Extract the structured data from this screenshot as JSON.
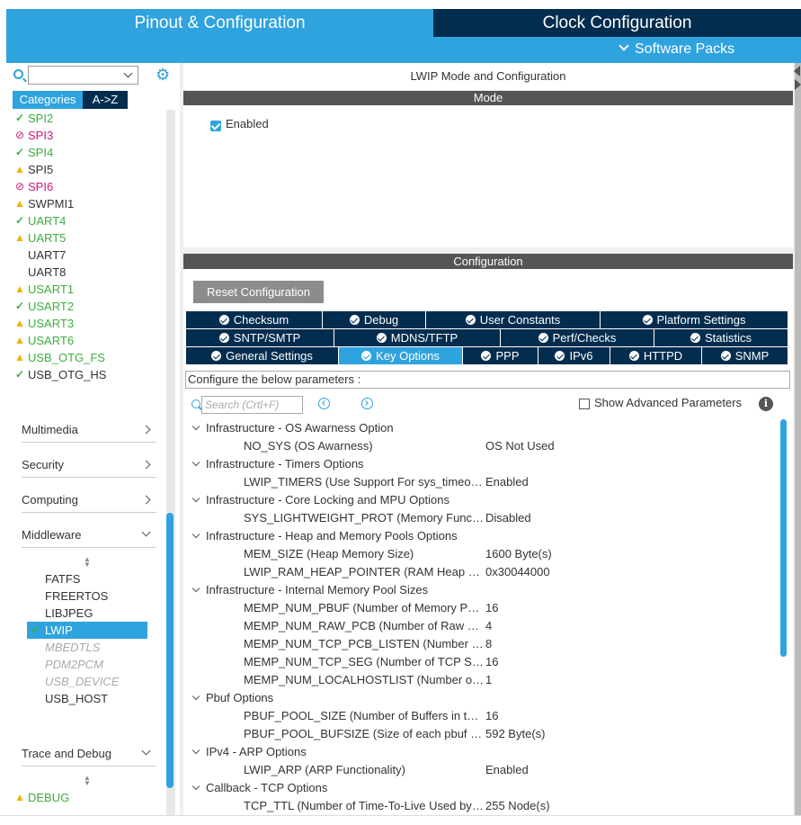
{
  "header": {
    "pinout_tab": "Pinout & Configuration",
    "clock_tab": "Clock Configuration",
    "software_packs": "Software Packs"
  },
  "sidebar": {
    "select_value": "",
    "tab_categories": "Categories",
    "tab_az": "A->Z",
    "peripherals": [
      {
        "label": "SPI2",
        "status": "ok"
      },
      {
        "label": "SPI3",
        "status": "error"
      },
      {
        "label": "SPI4",
        "status": "ok"
      },
      {
        "label": "SPI5",
        "status": "warning-plain"
      },
      {
        "label": "SPI6",
        "status": "error"
      },
      {
        "label": "SWPMI1",
        "status": "warning-plain"
      },
      {
        "label": "UART4",
        "status": "ok"
      },
      {
        "label": "UART5",
        "status": "warning"
      },
      {
        "label": "UART7",
        "status": "none"
      },
      {
        "label": "UART8",
        "status": "none"
      },
      {
        "label": "USART1",
        "status": "warning"
      },
      {
        "label": "USART2",
        "status": "ok"
      },
      {
        "label": "USART3",
        "status": "warning"
      },
      {
        "label": "USART6",
        "status": "warning"
      },
      {
        "label": "USB_OTG_FS",
        "status": "warning"
      },
      {
        "label": "USB_OTG_HS",
        "status": "ok-plain"
      }
    ],
    "categories": {
      "multimedia": "Multimedia",
      "security": "Security",
      "computing": "Computing",
      "middleware": "Middleware",
      "trace_debug": "Trace and Debug"
    },
    "middleware_items": [
      {
        "label": "FATFS",
        "state": "normal"
      },
      {
        "label": "FREERTOS",
        "state": "normal"
      },
      {
        "label": "LIBJPEG",
        "state": "normal"
      },
      {
        "label": "LWIP",
        "state": "selected"
      },
      {
        "label": "MBEDTLS",
        "state": "disabled"
      },
      {
        "label": "PDM2PCM",
        "state": "disabled"
      },
      {
        "label": "USB_DEVICE",
        "state": "disabled"
      },
      {
        "label": "USB_HOST",
        "state": "normal"
      }
    ],
    "debug_item": "DEBUG"
  },
  "main": {
    "title": "LWIP Mode and Configuration",
    "mode_header": "Mode",
    "enabled_label": "Enabled",
    "enabled_checked": true,
    "configuration_header": "Configuration",
    "reset_button": "Reset Configuration",
    "tabs_row1": [
      "Checksum",
      "Debug",
      "User Constants",
      "Platform Settings"
    ],
    "tabs_row2": [
      "SNTP/SMTP",
      "MDNS/TFTP",
      "Perf/Checks",
      "Statistics"
    ],
    "tabs_row3": [
      "General Settings",
      "Key Options",
      "PPP",
      "IPv6",
      "HTTPD",
      "SNMP"
    ],
    "active_tab": "Key Options",
    "hint": "Configure the below parameters :",
    "search_placeholder": "Search (Crtl+F)",
    "show_advanced": "Show Advanced Parameters",
    "info_icon": "i",
    "tree": [
      {
        "type": "group",
        "label": "Infrastructure - OS Awarness Option"
      },
      {
        "type": "param",
        "label": "NO_SYS (OS Awarness)",
        "value": "OS Not Used"
      },
      {
        "type": "group",
        "label": "Infrastructure - Timers Options"
      },
      {
        "type": "param",
        "label": "LWIP_TIMERS (Use Support For sys_timeouts)",
        "value": "Enabled"
      },
      {
        "type": "group",
        "label": "Infrastructure - Core Locking and MPU Options"
      },
      {
        "type": "param",
        "label": "SYS_LIGHTWEIGHT_PROT (Memory Functions Protection)",
        "value": "Disabled"
      },
      {
        "type": "group",
        "label": "Infrastructure - Heap and Memory Pools Options"
      },
      {
        "type": "param",
        "label": "MEM_SIZE (Heap Memory Size)",
        "value": "1600 Byte(s)"
      },
      {
        "type": "param",
        "label": "LWIP_RAM_HEAP_POINTER (RAM Heap Pointer)",
        "value": "0x30044000"
      },
      {
        "type": "group",
        "label": "Infrastructure - Internal Memory Pool Sizes"
      },
      {
        "type": "param",
        "label": "MEMP_NUM_PBUF (Number of Memory Pool Buffers)",
        "value": "16"
      },
      {
        "type": "param",
        "label": "MEMP_NUM_RAW_PCB (Number of Raw Protocol Control Blocks)",
        "value": "4"
      },
      {
        "type": "param",
        "label": "MEMP_NUM_TCP_PCB_LISTEN (Number of Listening TCP Connections)",
        "value": "8"
      },
      {
        "type": "param",
        "label": "MEMP_NUM_TCP_SEG (Number of TCP Segments)",
        "value": "16"
      },
      {
        "type": "param",
        "label": "MEMP_NUM_LOCALHOSTLIST (Number of Host IP Addresses)",
        "value": "1"
      },
      {
        "type": "group",
        "label": "Pbuf Options"
      },
      {
        "type": "param",
        "label": "PBUF_POOL_SIZE (Number of Buffers in the Pool)",
        "value": "16"
      },
      {
        "type": "param",
        "label": "PBUF_POOL_BUFSIZE (Size of each pbuf in the Pool)",
        "value": "592 Byte(s)"
      },
      {
        "type": "group",
        "label": "IPv4 - ARP Options"
      },
      {
        "type": "param",
        "label": "LWIP_ARP (ARP Functionality)",
        "value": "Enabled"
      },
      {
        "type": "group",
        "label": "Callback - TCP Options"
      },
      {
        "type": "param",
        "label": "TCP_TTL (Number of Time-To-Live Used by TCP Packets)",
        "value": "255 Node(s)"
      }
    ]
  },
  "colors": {
    "accent": "#2fa3de",
    "dark_navy": "#032d4f",
    "ok_green": "#3cae3c",
    "warning_yellow": "#f0b400",
    "error_magenta": "#d0157a",
    "section_bar": "#555555"
  },
  "icons": {
    "ok": "check-icon",
    "warning": "warning-icon",
    "error": "no-entry-icon",
    "settings": "gear-icon",
    "search": "search-icon",
    "info": "info-icon"
  }
}
